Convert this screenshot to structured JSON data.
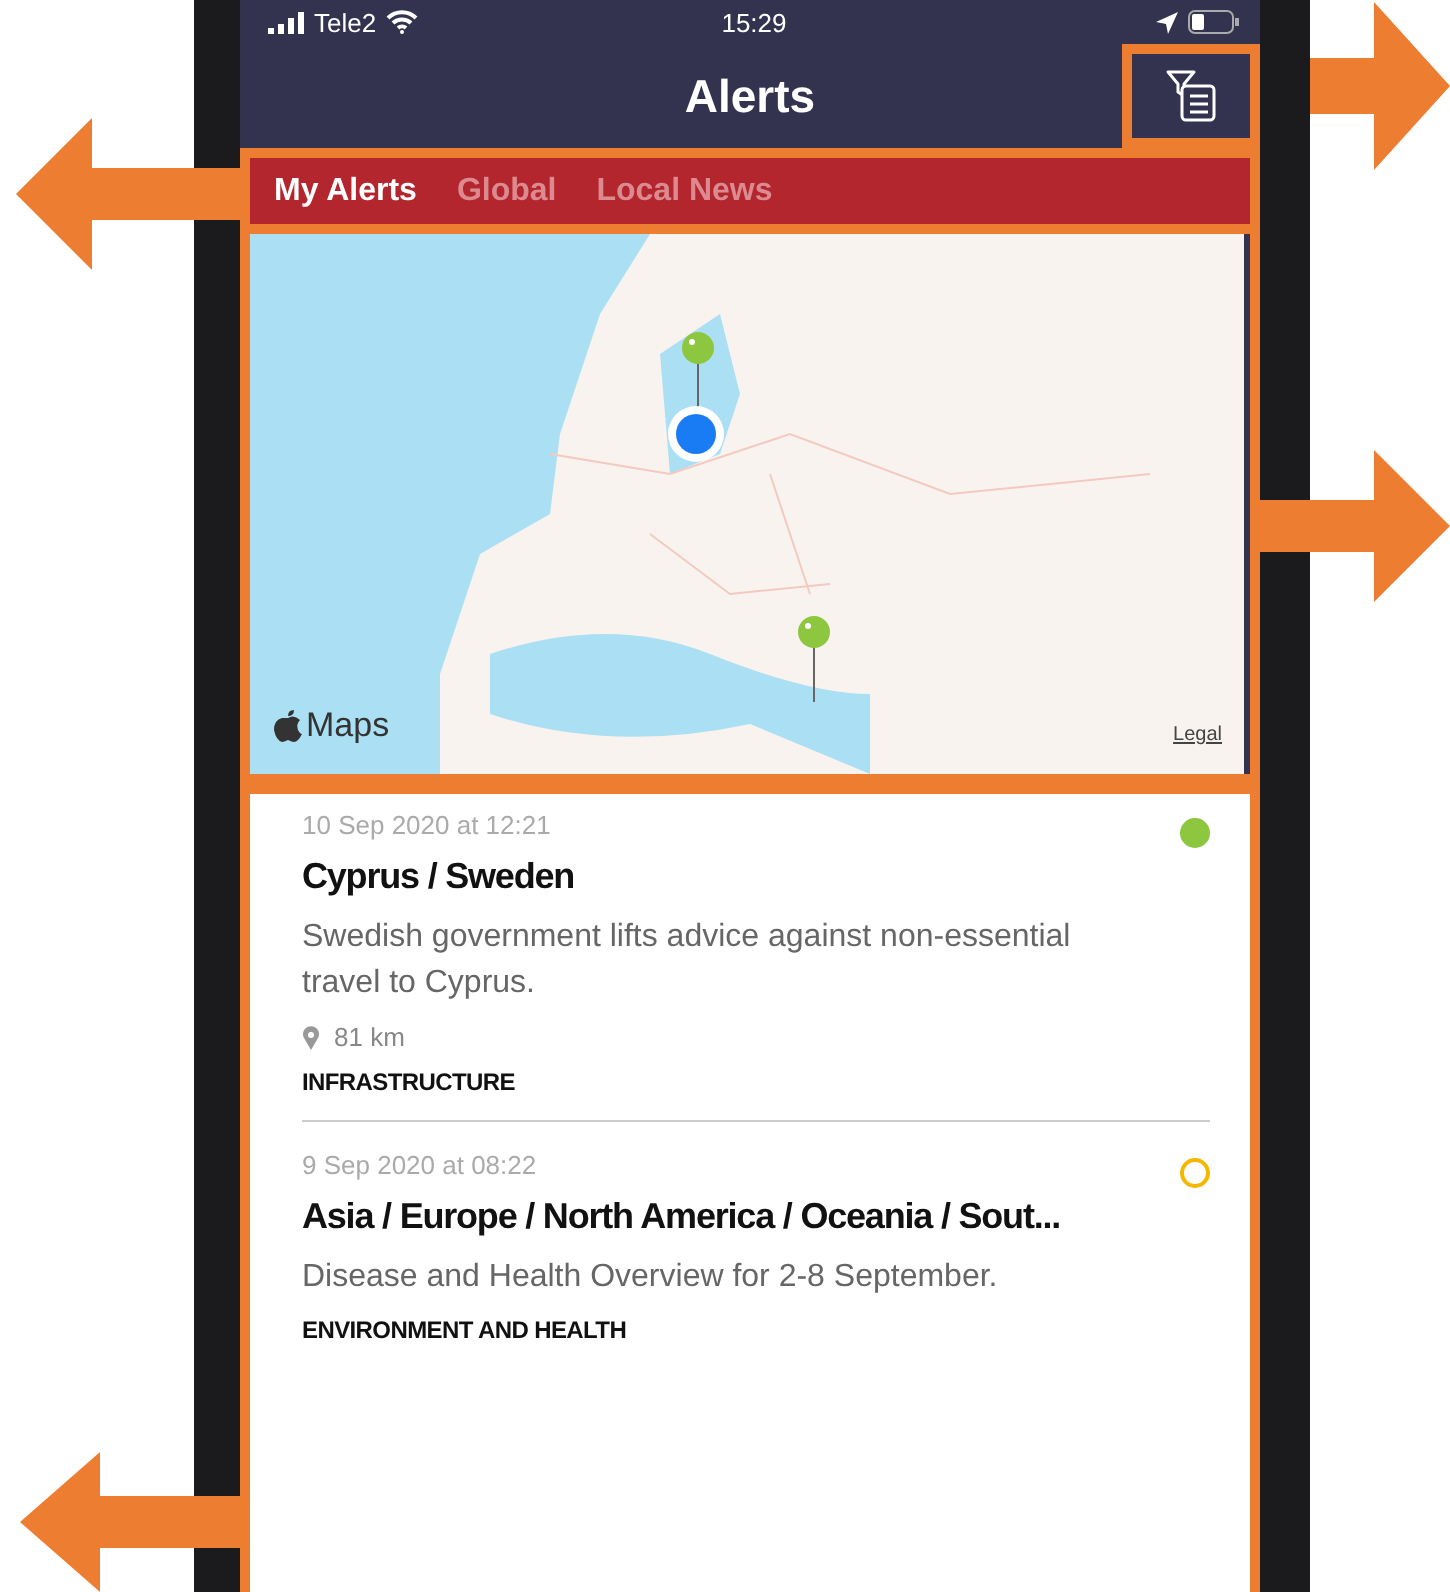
{
  "status_bar": {
    "carrier": "Tele2",
    "time": "15:29"
  },
  "header": {
    "title": "Alerts"
  },
  "tabs": [
    {
      "label": "My Alerts",
      "selected": true
    },
    {
      "label": "Global",
      "selected": false
    },
    {
      "label": "Local News",
      "selected": false
    }
  ],
  "map": {
    "logo": "Maps",
    "legal_link": "Legal"
  },
  "alerts": [
    {
      "date": "10 Sep 2020 at 12:21",
      "title": "Cyprus / Sweden",
      "description": "Swedish government lifts advice against non-essential travel to Cyprus.",
      "distance": "81 km",
      "category": "INFRASTRUCTURE",
      "color": "#8dc63f",
      "filled": true
    },
    {
      "date": "9 Sep 2020 at 08:22",
      "title": "Asia / Europe / North America / Oceania / Sout...",
      "description": "Disease and Health Overview for 2-8 September.",
      "category": "ENVIRONMENT AND HEALTH",
      "color": "#f5b800",
      "filled": false
    }
  ]
}
